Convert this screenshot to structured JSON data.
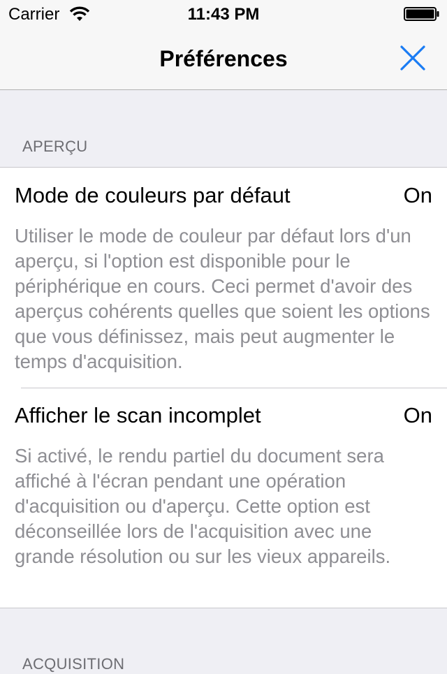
{
  "status_bar": {
    "carrier": "Carrier",
    "time": "11:43 PM",
    "wifi_icon": "wifi-icon",
    "battery_icon": "battery-icon"
  },
  "nav": {
    "title": "Préférences",
    "close_icon": "close-icon"
  },
  "colors": {
    "accent": "#1a7cf4",
    "background": "#efeff4",
    "secondary_text": "#8e8e93",
    "section_header": "#6d6d72"
  },
  "sections": [
    {
      "header": "APERÇU",
      "cells": [
        {
          "title": "Mode de couleurs par défaut",
          "value": "On",
          "description": "Utiliser le mode de couleur par défaut lors d'un aperçu, si l'option est disponible pour le périphérique en cours. Ceci permet d'avoir des aperçus cohérents quelles que soient les options que vous définissez, mais peut augmenter le temps d'acquisition."
        },
        {
          "title": "Afficher le scan incomplet",
          "value": "On",
          "description": "Si activé, le rendu partiel du document sera affiché à l'écran pendant une opération d'acquisition ou d'aperçu. Cette option est déconseillée lors de l'acquisition avec une grande résolution ou sur les vieux appareils."
        }
      ]
    },
    {
      "header": "ACQUISITION",
      "cells": []
    }
  ]
}
